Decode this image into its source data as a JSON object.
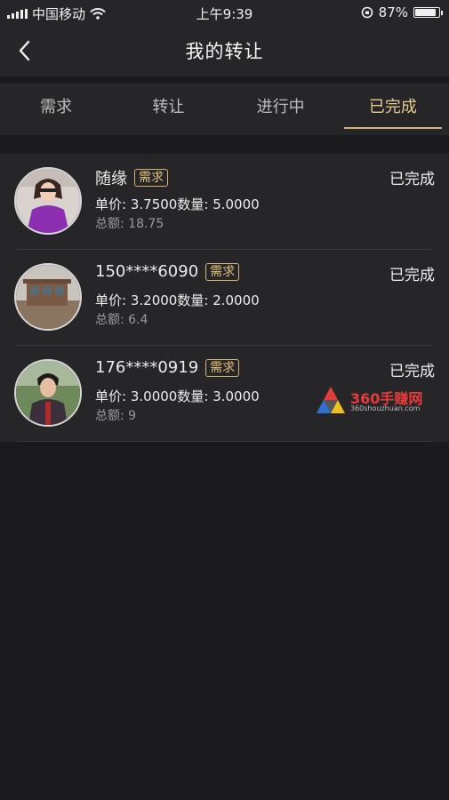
{
  "status_bar": {
    "carrier": "中国移动",
    "time": "上午9:39",
    "battery_percent": "87%",
    "battery_level": 0.87
  },
  "nav": {
    "title": "我的转让",
    "back_icon": "chevron-left-icon"
  },
  "tabs": [
    {
      "label": "需求",
      "active": false
    },
    {
      "label": "转让",
      "active": false
    },
    {
      "label": "进行中",
      "active": false
    },
    {
      "label": "已完成",
      "active": true
    }
  ],
  "items": [
    {
      "name": "随缘",
      "tag": "需求",
      "price_label": "单价:",
      "price": "3.7500",
      "qty_label": "数量:",
      "qty": "5.0000",
      "total_label": "总额:",
      "total": "18.75",
      "status": "已完成"
    },
    {
      "name": "150****6090",
      "tag": "需求",
      "price_label": "单价:",
      "price": "3.2000",
      "qty_label": "数量:",
      "qty": "2.0000",
      "total_label": "总额:",
      "total": "6.4",
      "status": "已完成"
    },
    {
      "name": "176****0919",
      "tag": "需求",
      "price_label": "单价:",
      "price": "3.0000",
      "qty_label": "数量:",
      "qty": "3.0000",
      "total_label": "总额:",
      "total": "9",
      "status": "已完成"
    }
  ],
  "watermark": {
    "text": "360手赚网",
    "sub": "360shouzhuan.com"
  },
  "colors": {
    "background": "#1b1b1d",
    "panel": "#262628",
    "accent": "#e8c98b",
    "text": "#ececec"
  }
}
